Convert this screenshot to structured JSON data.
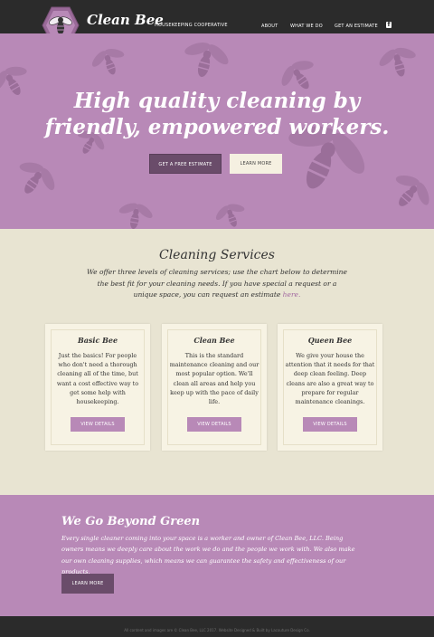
{
  "header": {
    "brand": "Clean Bee",
    "tagline": "HOUSEKEEPING COOPERATIVE",
    "nav": [
      "ABOUT",
      "WHAT WE DO",
      "GET AN ESTIMATE"
    ],
    "social_icon": "facebook-icon"
  },
  "hero": {
    "title_line1": "High quality cleaning by",
    "title_line2": "friendly, empowered workers.",
    "primary_button": "GET A FREE ESTIMATE",
    "secondary_button": "LEARN MORE"
  },
  "services": {
    "title": "Cleaning Services",
    "description": "We offer three levels of cleaning services; use the chart below to determine the best fit for your cleaning needs. If you have special a request or a unique space, you can request an estimate ",
    "description_link": "here.",
    "cards": [
      {
        "title": "Basic Bee",
        "text": "Just the basics! For people who don't need a thorough cleaning all of the time, but want a cost effective way to get some help with housekeeping.",
        "button": "VIEW DETAILS"
      },
      {
        "title": "Clean Bee",
        "text": "This is the standard maintenance cleaning and our most popular option. We'll clean all areas and help you keep up with the pace of daily life.",
        "button": "VIEW DETAILS"
      },
      {
        "title": "Queen Bee",
        "text": "We give your house the attention that it needs for that deep clean feeling. Deep cleans are also a great way to prepare for regular maintenance cleanings.",
        "button": "VIEW DETAILS"
      }
    ]
  },
  "green": {
    "title": "We Go Beyond Green",
    "text": "Every single cleaner coming into your space is a worker and owner of Clean Bee, LLC. Being owners means we deeply care about the work we do and the people we work with. We also make our own cleaning supplies, which means we can guarantee the safety and effectiveness of our products.",
    "button": "LEARN MORE"
  },
  "footer": {
    "text": "All content and images are © Clean Bee, LLC 2017. Website Designed & Built by Lacouture Design Co."
  },
  "colors": {
    "lavender": "#b889b7",
    "plum": "#6a4c6a",
    "cream": "#e8e4d2",
    "dark": "#2b2b2b"
  }
}
